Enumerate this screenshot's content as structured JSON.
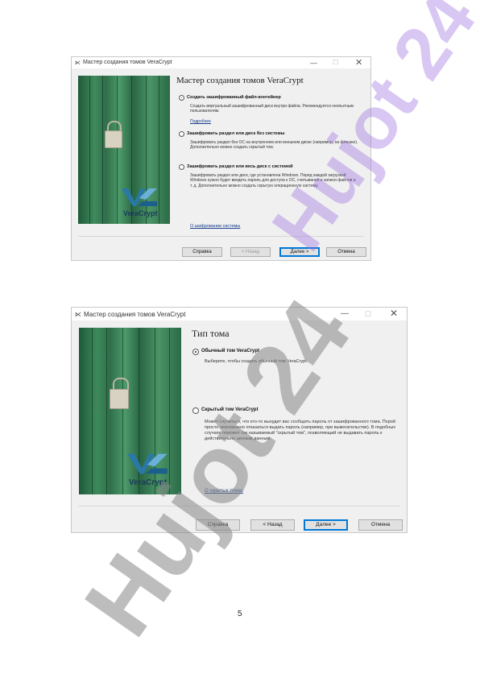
{
  "window1": {
    "title": "Мастер создания томов VeraCrypt",
    "heading": "Мастер создания томов VeraCrypt",
    "options": [
      {
        "label": "Создать зашифрованный файл-контейнер",
        "selected": true,
        "description": "Создать виртуальный зашифрованный диск внутри файла. Рекомендуется неопытным пользователям."
      },
      {
        "label": "Зашифровать раздел или диск без системы",
        "selected": false,
        "description": "Зашифровать раздел без ОС на внутреннем или внешнем диске (например, на флешке). Дополнительно можно создать скрытый том."
      },
      {
        "label": "Зашифровать раздел или весь диск с системой",
        "selected": false,
        "description": "Зашифровать раздел или диск, где установлена Windows. Перед каждой загрузкой Windows нужно будет вводить пароль для доступа к ОС, считывания и записи файлов и т. д. Дополнительно можно создать скрытую операционную систему."
      }
    ],
    "more_link": "Подробнее",
    "system_link": "О шифровании системы",
    "buttons": {
      "help": "Справка",
      "back": "< Назад",
      "next": "Далее >",
      "cancel": "Отмена"
    },
    "logo_text": "VeraCrypt"
  },
  "window2": {
    "title": "Мастер создания томов VeraCrypt",
    "heading": "Тип тома",
    "options": [
      {
        "label": "Обычный том VeraCrypt",
        "selected": true,
        "description": "Выберите, чтобы создать обычный том VeraCrypt."
      },
      {
        "label": "Скрытый том VeraCrypt",
        "selected": false,
        "description": "Может случиться, что кто-то вынудит вас сообщить пароль от зашифрованного тома. Порой просто невозможно отказаться выдать пароль (например, при вымогательстве). В подобных случаях поможет так называемый \"скрытый том\", позволяющий не выдавать пароль к действительно ценным данным."
      }
    ],
    "hidden_link": "О скрытых томах",
    "buttons": {
      "help": "Справка",
      "back": "< Назад",
      "next": "Далее >",
      "cancel": "Отмена"
    },
    "logo_text": "VeraCrypt"
  },
  "page_number": "5",
  "watermark": {
    "text": "Hujot 24",
    "color": "#9b6ee0"
  },
  "colors": {
    "accent": "#0078d7",
    "link": "#1a3e8c",
    "window_bg": "#f0f0f0"
  }
}
